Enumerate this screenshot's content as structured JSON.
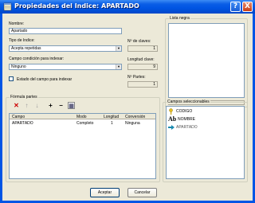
{
  "window": {
    "title": "Propiedades del Indice: APARTADO",
    "help_label": "?",
    "close_label": "X"
  },
  "form": {
    "name_label": "Nombre:",
    "name_value": "Apartado",
    "type_label": "Tipo de Indice:",
    "type_value": "Acepta repetidas",
    "condition_label": "Campo condición para indexar:",
    "condition_value": "Ninguno",
    "state_checkbox_label": "Estado del campo para indexar",
    "num_keys_label": "Nº de claves:",
    "num_keys_value": "1",
    "key_length_label": "Longitud clave:",
    "key_length_value": "9",
    "num_parts_label": "Nº Partes:",
    "num_parts_value": "1"
  },
  "black_list": {
    "label": "Lista negra"
  },
  "formula": {
    "label": "Fórmula partes",
    "columns": [
      "Campo",
      "Modo",
      "Longitud",
      "Conversión"
    ],
    "rows": [
      {
        "campo": "APARTADO",
        "modo": "Completo",
        "longitud": "1",
        "conversion": "Ninguna"
      }
    ],
    "tools": {
      "delete": "✕",
      "up": "↑",
      "down": "↓",
      "add": "+",
      "remove": "−",
      "edit": "▦"
    }
  },
  "selected_fields": {
    "label": "Campos seleccionables",
    "items": [
      {
        "label": "CODIGO",
        "icon": "key-icon"
      },
      {
        "label": "NOMBRE",
        "icon": "ab-text-icon"
      },
      {
        "label": "APARTADO",
        "icon": "arrow-icon"
      }
    ]
  },
  "buttons": {
    "accept": "Aceptar",
    "cancel": "Cancelar"
  }
}
